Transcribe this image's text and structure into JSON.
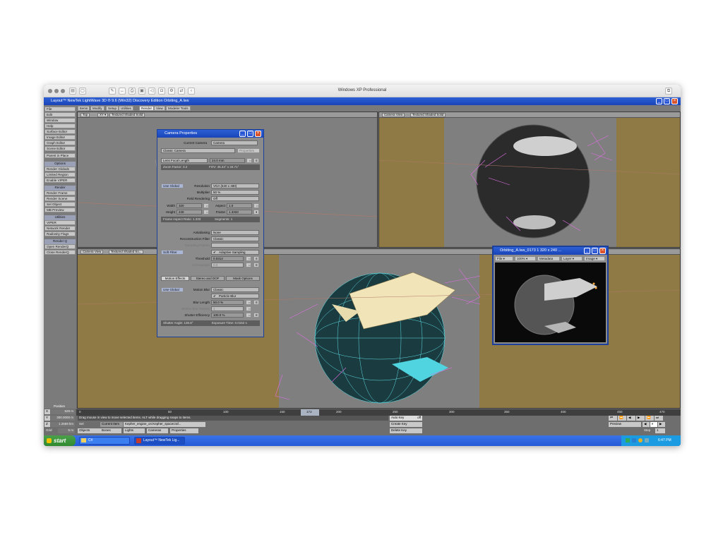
{
  "mac": {
    "title": "Windows XP Professional"
  },
  "app": {
    "title": "Layout™ NewTek LightWave 3D ® 9.6  (Win32) Discovery Edition  Orbiting_A.lws"
  },
  "tabs": [
    "Items",
    "Modify",
    "Setup",
    "Utilities",
    "Render",
    "View",
    "Modeler Tools"
  ],
  "sidebar": {
    "top": [
      "File",
      "Edit",
      "Window",
      "Help",
      "Surface Editor",
      "Image Editor",
      "Graph Editor",
      "Scene Editor"
    ],
    "parent": "Parent in Place",
    "options_header": "Options",
    "options": [
      "Render Globals",
      "Limited Region",
      "Enable VIPER"
    ],
    "render_header": "Render",
    "render": [
      "Render Frame",
      "Render Scene",
      "Sel Object",
      "MB Preview"
    ],
    "utilities_header": "Utilities",
    "utilities": [
      "VIPER",
      "Network Render",
      "Radiosity Flags"
    ],
    "renderq_header": "Render Q",
    "renderq": [
      "Open RenderQ",
      "Close RenderQ"
    ]
  },
  "viewports": {
    "tl": {
      "view": "Top",
      "shade": "Textured Shaded Solid"
    },
    "tr": {
      "view": "Camera View",
      "shade": "Textured Shaded Solid"
    },
    "bl": {
      "view": "Camera View",
      "shade": "Textured Shaded So..."
    }
  },
  "camera": {
    "title": "Camera Properties",
    "current_label": "Current Camera",
    "current_value": "Camera",
    "type": "Classic Camera",
    "properties": "Properties",
    "lens_mode": "Lens Focal Length",
    "lens_value": "24.0 mm",
    "zoom_factor": "Zoom Factor: 3.2",
    "fov": "FOV: 45.24° x 34.71°",
    "use_global": "Use Global",
    "resolution_label": "Resolution",
    "resolution": "VGA (640 x 480)",
    "multiplier_label": "Multiplier",
    "multiplier": "50 %",
    "field_label": "Field Rendering",
    "field": "Off",
    "width_label": "Width",
    "width": "320",
    "aspect_label": "Aspect",
    "aspect": "1.0",
    "height_label": "Height",
    "height": "240",
    "frame_label": "Frame",
    "frame": "1.3333",
    "frame_aspect": "Frame Aspect Ratio: 1.333",
    "segments": "Segments: 1",
    "aa_label": "Antialiasing",
    "aa": "None",
    "recon_label": "Reconstruction Filter",
    "recon": "Classic",
    "sampling_label": "Sampling Pattern",
    "soft_filter": "Soft Filter",
    "adaptive": "Adaptive Sampling",
    "threshold_label": "Threshold",
    "threshold": "0.0314",
    "oversample_label": "Oversample",
    "oversample": "0.0",
    "subtabs": [
      "Motion Effects",
      "Stereo and DOF",
      "Mask Options"
    ],
    "use_global2": "Use Global",
    "mblur_label": "Motion Blur",
    "mblur": "Classic",
    "particle_blur": "Particle Blur",
    "blur_length_label": "Blur Length",
    "blur_length": "50.0 %",
    "mb_passes_label": "Motion Blur Passes",
    "mb_passes": "1",
    "shutter_eff_label": "Shutter Efficiency",
    "shutter_eff": "100.0 %",
    "shutter_angle": "Shutter Angle: 136.8°",
    "exposure": "Exposure Time: 0.0152 s"
  },
  "orbit": {
    "title": "Orbiting_A.lws_0173  1   320 x 240 ...",
    "menu": [
      "File",
      "100%",
      "Metadata",
      "Layer",
      "Image"
    ]
  },
  "timeline": {
    "position_label": "Position",
    "ticks": [
      "0",
      "50",
      "100",
      "150",
      "200",
      "250",
      "300",
      "350",
      "400",
      "450",
      "470"
    ],
    "current_frame": "172",
    "x": "X",
    "y": "Y",
    "z": "Z",
    "grid": "Grid",
    "x_val": "529 m",
    "y_val": "300.0000 m",
    "z_val": "1.2669 km",
    "grid_val": "5 m",
    "status_msg": "Drag mouse in view to move selected items. ALT while dragging snaps to items.",
    "sel": "Sel",
    "current_item": "Current Item",
    "current_item_val": "Kepher_engine_on:Kepher_spacecraf...",
    "objects": "Objects",
    "bones": "Bones",
    "lights": "Lights",
    "cameras": "Cameras",
    "properties": "Properties",
    "auto_key": "Auto Key",
    "auto_key_val": "off",
    "create_key": "Create Key",
    "delete_key": "Delete Key",
    "preview": "Preview",
    "step_label": "Step",
    "step": "1"
  },
  "taskbar": {
    "start": "start",
    "items": [
      "C#",
      "Layout™ NewTek Lig..."
    ],
    "clock": "6:47 PM"
  }
}
